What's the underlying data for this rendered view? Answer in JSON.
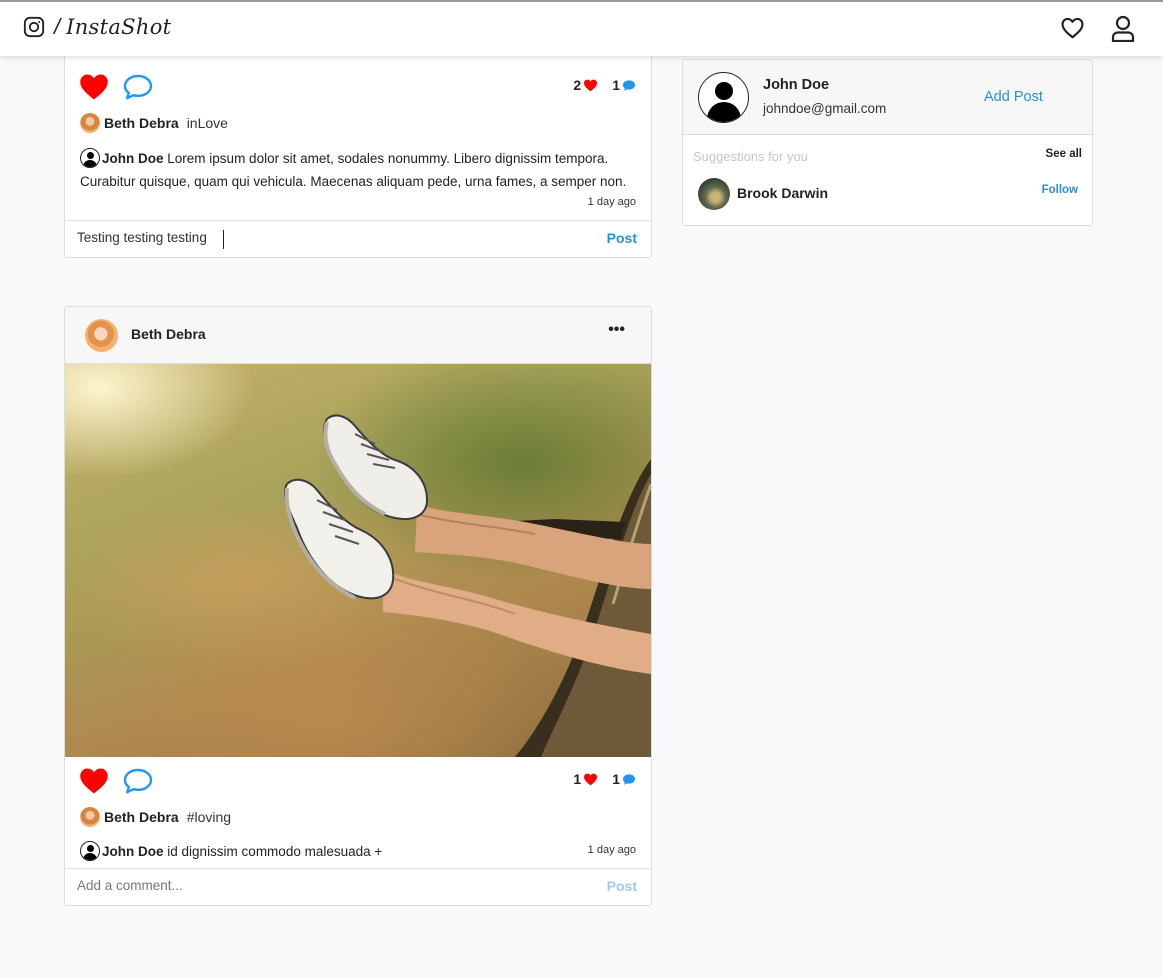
{
  "app": {
    "brand_separator": "/",
    "brand_name": "InstaShot",
    "icons": {
      "logo": "instagram-icon",
      "notifications": "heart-outline-icon",
      "profile": "user-icon"
    }
  },
  "colors": {
    "accent": "#2a90d4",
    "like": "#ff0000",
    "comment_icon": "#2196f3"
  },
  "posts": [
    {
      "likes": "2",
      "comment_count": "1",
      "author": "Beth Debra",
      "caption": "inLove",
      "comment": {
        "user": "John Doe",
        "text": "Lorem ipsum dolor sit amet, sodales nonummy. Libero dignissim tempora. Curabitur quisque, quam qui vehicula. Maecenas aliquam pede, urna fames, a semper non."
      },
      "time": "1 day ago",
      "comment_input_value": "Testing testing testing",
      "post_label": "Post"
    },
    {
      "author": "Beth Debra",
      "more_label": "•••",
      "likes": "1",
      "comment_count": "1",
      "caption": "#loving",
      "comment": {
        "user": "John Doe",
        "text": "id dignissim commodo malesuada +"
      },
      "time": "1 day ago",
      "comment_placeholder": "Add a comment...",
      "post_label": "Post"
    }
  ],
  "sidebar": {
    "user_name": "John Doe",
    "user_email": "johndoe@gmail.com",
    "add_post_label": "Add Post",
    "suggestions_title": "Suggestions for you",
    "see_all_label": "See all",
    "suggestions": [
      {
        "name": "Brook Darwin",
        "action": "Follow"
      }
    ]
  }
}
